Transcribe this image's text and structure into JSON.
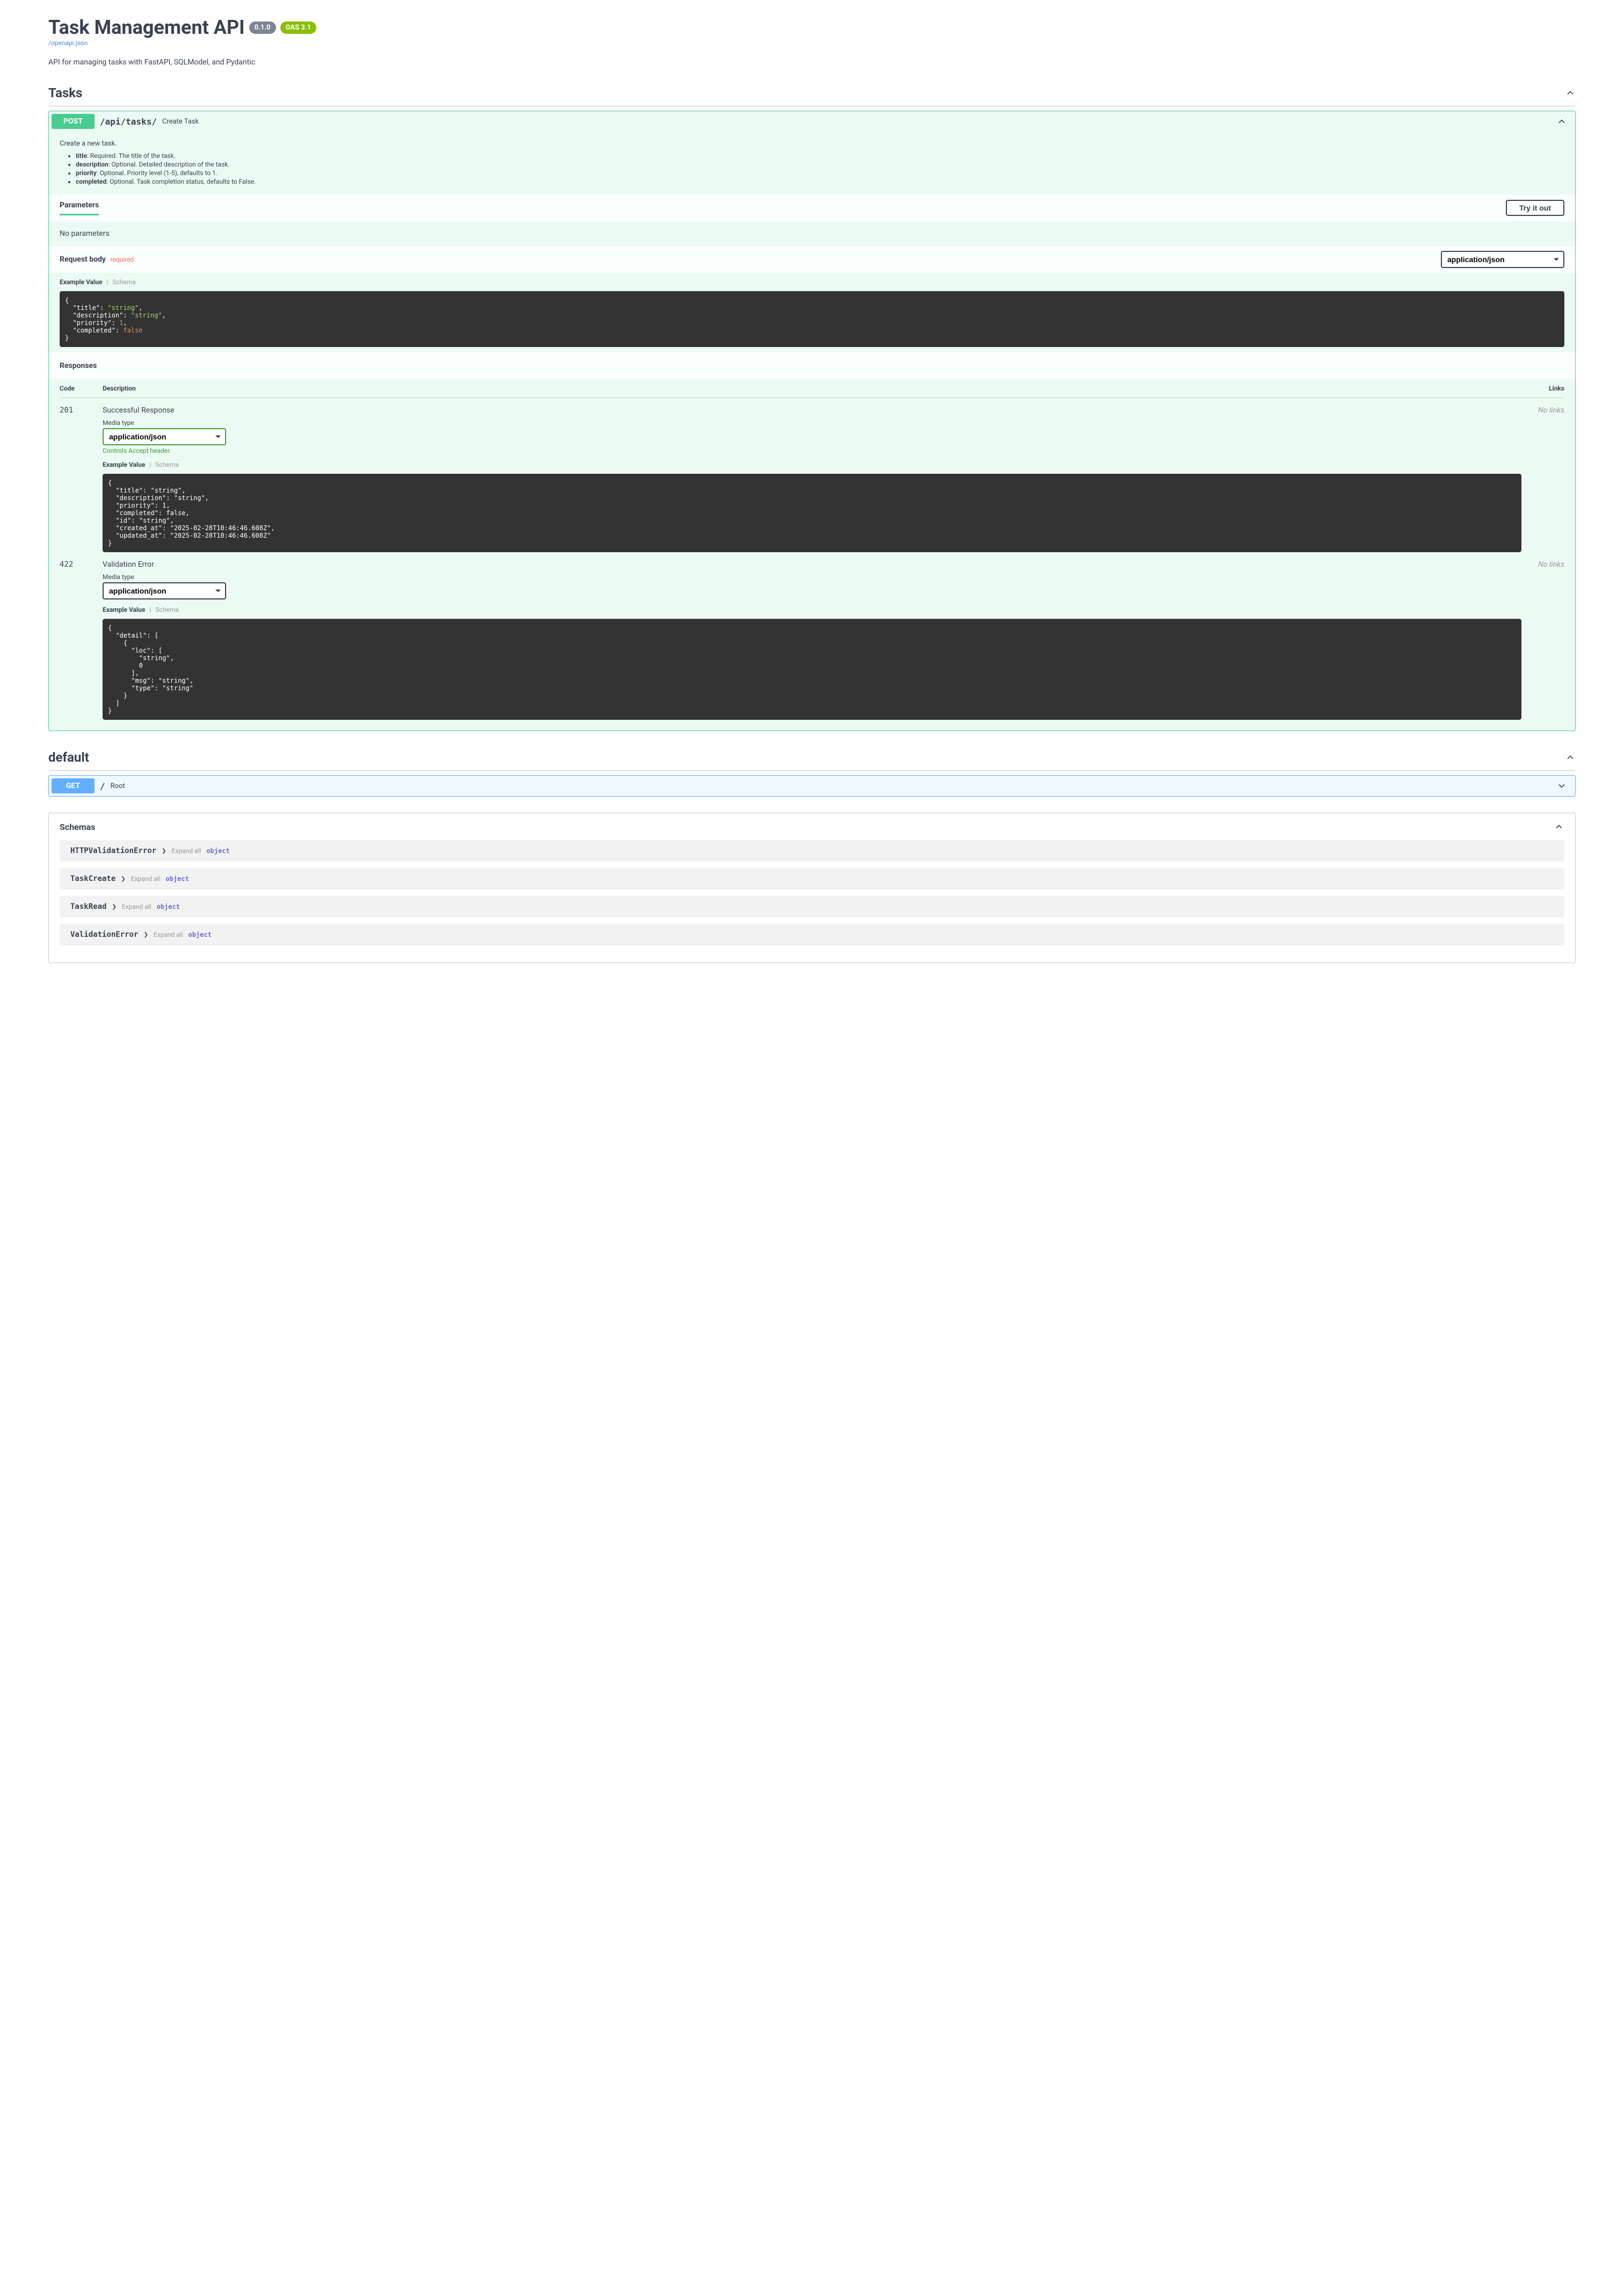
{
  "header": {
    "title": "Task Management API",
    "version": "0.1.0",
    "oas": "OAS 3.1",
    "openapi_link": "/openapi.json",
    "description": "API for managing tasks with FastAPI, SQLModel, and Pydantic"
  },
  "sections": {
    "tasks": {
      "title": "Tasks"
    },
    "default": {
      "title": "default"
    },
    "schemas": {
      "title": "Schemas"
    }
  },
  "opblock_post": {
    "method": "POST",
    "path": "/api/tasks/",
    "summary": "Create Task",
    "desc_intro": "Create a new task.",
    "fields": [
      {
        "name": "title",
        "text": ": Required. The title of the task."
      },
      {
        "name": "description",
        "text": ": Optional. Detailed description of the task."
      },
      {
        "name": "priority",
        "text": ": Optional. Priority level (1-5), defaults to 1."
      },
      {
        "name": "completed",
        "text": ": Optional. Task completion status, defaults to False."
      }
    ],
    "parameters_label": "Parameters",
    "try_it_out": "Try it out",
    "no_parameters": "No parameters",
    "request_body_label": "Request body",
    "required_label": "required",
    "content_type": "application/json",
    "example_value_label": "Example Value",
    "schema_label": "Schema",
    "responses_label": "Responses",
    "col_code": "Code",
    "col_desc": "Description",
    "col_links": "Links",
    "media_type_label": "Media type",
    "accept_note": "Controls Accept header.",
    "no_links": "No links"
  },
  "request_body_example": "{\n  \"title\": \"string\",\n  \"description\": \"string\",\n  \"priority\": 1,\n  \"completed\": false\n}",
  "responses": {
    "r201": {
      "code": "201",
      "title": "Successful Response",
      "media_type": "application/json",
      "example": "{\n  \"title\": \"string\",\n  \"description\": \"string\",\n  \"priority\": 1,\n  \"completed\": false,\n  \"id\": \"string\",\n  \"created_at\": \"2025-02-28T10:46:46.608Z\",\n  \"updated_at\": \"2025-02-28T10:46:46.608Z\"\n}"
    },
    "r422": {
      "code": "422",
      "title": "Validation Error",
      "media_type": "application/json",
      "example": "{\n  \"detail\": [\n    {\n      \"loc\": [\n        \"string\",\n        0\n      ],\n      \"msg\": \"string\",\n      \"type\": \"string\"\n    }\n  ]\n}"
    }
  },
  "opblock_get": {
    "method": "GET",
    "path": "/",
    "summary": "Root"
  },
  "schemas": {
    "expand_all": "Expand all",
    "object_label": "object",
    "items": [
      "HTTPValidationError",
      "TaskCreate",
      "TaskRead",
      "ValidationError"
    ]
  }
}
